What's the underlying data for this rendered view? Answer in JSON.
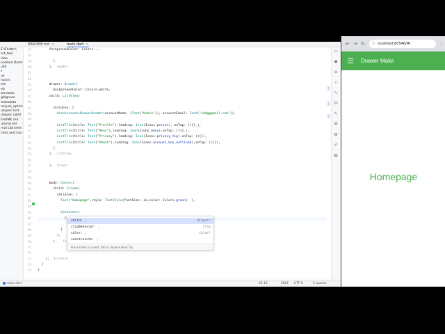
{
  "ide": {
    "tabs": [
      {
        "label": "README.md",
        "active": false
      },
      {
        "label": "main.dart",
        "active": true
      }
    ],
    "project_tree": [
      "E:\\Flutter\\",
      "art_tool",
      "idea",
      "android [tutorial",
      "uild",
      "s",
      "ux",
      "nacos",
      "est",
      "eb",
      "windows",
      "gitignore",
      "metadata",
      "nalysis_options",
      "ubspec.lock",
      "ubspec.yaml",
      "EADME.md",
      "utorial.iml",
      "rnal Libraries",
      "ches and Con"
    ],
    "line_numbers": [
      "37",
      "38",
      "39",
      "40",
      "41",
      "42",
      "43",
      "44",
      "45",
      "46",
      "47",
      "48",
      "49",
      "50",
      "51",
      "52",
      "53",
      "54",
      "55",
      "56",
      "57",
      "58",
      "59",
      "60",
      "61",
      "62",
      "63",
      "64",
      "65",
      "66",
      "67",
      "68",
      "69",
      "70",
      "71",
      "72",
      "73",
      "74",
      "75"
    ],
    "code_lines": [
      {
        "indent": "      ",
        "parts": [
          {
            "t": "foregroundColor: Colors.",
            "c": ""
          },
          {
            "t": "...",
            "c": ""
          }
        ]
      },
      {
        "indent": "",
        "parts": []
      },
      {
        "indent": "        ",
        "parts": [
          {
            "t": "],",
            "c": ""
          }
        ]
      },
      {
        "indent": "      ",
        "parts": [
          {
            "t": "),",
            "c": ""
          }
        ],
        "tag": "AppBar"
      },
      {
        "indent": "",
        "parts": []
      },
      {
        "indent": "",
        "parts": []
      },
      {
        "indent": "      ",
        "parts": [
          {
            "t": "drawer: ",
            "c": ""
          },
          {
            "t": "Drawer",
            "c": "cls"
          },
          {
            "t": "(",
            "c": ""
          }
        ]
      },
      {
        "indent": "        ",
        "parts": [
          {
            "t": "backgroundColor: Colors.white,",
            "c": ""
          }
        ]
      },
      {
        "indent": "      ",
        "parts": [
          {
            "t": "child: ",
            "c": ""
          },
          {
            "t": "ListView",
            "c": "cls"
          },
          {
            "t": "(",
            "c": ""
          }
        ]
      },
      {
        "indent": "",
        "parts": []
      },
      {
        "indent": "        ",
        "parts": [
          {
            "t": "children: [",
            "c": ""
          }
        ]
      },
      {
        "indent": "          ",
        "parts": [
          {
            "t": "UserAccountsDrawerHeader",
            "c": "cls"
          },
          {
            "t": "(accountName: (",
            "c": ""
          },
          {
            "t": "Text",
            "c": "cls"
          },
          {
            "t": "(",
            "c": ""
          },
          {
            "t": "\"Komin\"",
            "c": "str"
          },
          {
            "t": ")), accountEmail: ",
            "c": ""
          },
          {
            "t": "Text",
            "c": "cls"
          },
          {
            "t": "(",
            "c": ""
          },
          {
            "t": "\"sddg@gmail.com\"",
            "c": "str"
          },
          {
            "t": ")),",
            "c": ""
          }
        ]
      },
      {
        "indent": "",
        "parts": []
      },
      {
        "indent": "          ",
        "parts": [
          {
            "t": "ListTile",
            "c": "cls"
          },
          {
            "t": "(title: ",
            "c": ""
          },
          {
            "t": "Text",
            "c": "cls"
          },
          {
            "t": "(",
            "c": ""
          },
          {
            "t": "\"Profile\"",
            "c": "str"
          },
          {
            "t": "),leading: ",
            "c": ""
          },
          {
            "t": "Icon",
            "c": "cls"
          },
          {
            "t": "(Icons.",
            "c": ""
          },
          {
            "t": "person",
            "c": "kw"
          },
          {
            "t": "), onTap: (){}_),",
            "c": ""
          }
        ]
      },
      {
        "indent": "          ",
        "parts": [
          {
            "t": "ListTile",
            "c": "cls"
          },
          {
            "t": "(title: ",
            "c": ""
          },
          {
            "t": "Text",
            "c": "cls"
          },
          {
            "t": "(",
            "c": ""
          },
          {
            "t": "\"Menu\"",
            "c": "str"
          },
          {
            "t": "),leading: ",
            "c": ""
          },
          {
            "t": "Icon",
            "c": "cls"
          },
          {
            "t": "(Icons.",
            "c": ""
          },
          {
            "t": "menu",
            "c": "kw"
          },
          {
            "t": "),onTap: (){}_),",
            "c": ""
          }
        ]
      },
      {
        "indent": "          ",
        "parts": [
          {
            "t": "ListTile",
            "c": "cls"
          },
          {
            "t": "(title: ",
            "c": ""
          },
          {
            "t": "Text",
            "c": "cls"
          },
          {
            "t": "(",
            "c": ""
          },
          {
            "t": "\"Privacy\"",
            "c": "str"
          },
          {
            "t": "),leading: ",
            "c": ""
          },
          {
            "t": "Icon",
            "c": "cls"
          },
          {
            "t": "(Icons.",
            "c": ""
          },
          {
            "t": "privacy_tip",
            "c": "kw"
          },
          {
            "t": "),onTap: (){}),",
            "c": ""
          }
        ]
      },
      {
        "indent": "          ",
        "parts": [
          {
            "t": "ListTile",
            "c": "cls"
          },
          {
            "t": "(title: ",
            "c": ""
          },
          {
            "t": "Text",
            "c": "cls"
          },
          {
            "t": "(",
            "c": ""
          },
          {
            "t": "\"About\"",
            "c": "str"
          },
          {
            "t": "),leading: ",
            "c": ""
          },
          {
            "t": "Icon",
            "c": "cls"
          },
          {
            "t": "(Icons.",
            "c": ""
          },
          {
            "t": "account_box_outlined",
            "c": "kw"
          },
          {
            "t": "),onTap: (){}),",
            "c": ""
          }
        ]
      },
      {
        "indent": "        ",
        "parts": [
          {
            "t": "],",
            "c": ""
          }
        ]
      },
      {
        "indent": "      ",
        "parts": [
          {
            "t": "),",
            "c": ""
          }
        ],
        "tag": "ListView"
      },
      {
        "indent": "",
        "parts": []
      },
      {
        "indent": "      ",
        "parts": [
          {
            "t": "),",
            "c": ""
          }
        ],
        "tag": "Drawer"
      },
      {
        "indent": "",
        "parts": []
      },
      {
        "indent": "",
        "parts": []
      },
      {
        "indent": "      ",
        "parts": [
          {
            "t": "body: ",
            "c": ""
          },
          {
            "t": "Center",
            "c": "cls"
          },
          {
            "t": "(",
            "c": ""
          }
        ]
      },
      {
        "indent": "        ",
        "parts": [
          {
            "t": "child: ",
            "c": ""
          },
          {
            "t": "Column",
            "c": "cls"
          },
          {
            "t": "(",
            "c": ""
          }
        ]
      },
      {
        "indent": "          ",
        "parts": [
          {
            "t": "children: [",
            "c": ""
          }
        ]
      },
      {
        "indent": "            ",
        "parts": [
          {
            "t": "Text",
            "c": "cls"
          },
          {
            "t": "(",
            "c": ""
          },
          {
            "t": "\"Homepage\"",
            "c": "str"
          },
          {
            "t": ",style: ",
            "c": ""
          },
          {
            "t": "TextStyle",
            "c": "cls"
          },
          {
            "t": "(fontSize: 3a,color: Colors.",
            "c": ""
          },
          {
            "t": "green",
            "c": "kw"
          },
          {
            "t": ")  ),",
            "c": ""
          }
        ]
      },
      {
        "indent": "",
        "parts": []
      },
      {
        "indent": "            ",
        "parts": [
          {
            "t": "Container",
            "c": "cls"
          },
          {
            "t": "(",
            "c": ""
          }
        ]
      },
      {
        "indent": "              ",
        "parts": [
          {
            "t": "c",
            "c": ""
          }
        ]
      },
      {
        "indent": "",
        "parts": []
      },
      {
        "indent": "            ",
        "parts": [
          {
            "t": "]",
            "c": ""
          }
        ]
      },
      {
        "indent": "          ",
        "parts": [
          {
            "t": "),",
            "c": ""
          }
        ]
      },
      {
        "indent": "        ",
        "parts": [
          {
            "t": "), ",
            "c": ""
          }
        ],
        "tag": "Cen"
      },
      {
        "indent": "",
        "parts": []
      },
      {
        "indent": "",
        "parts": []
      },
      {
        "indent": "    ",
        "parts": [
          {
            "t": ");",
            "c": ""
          }
        ],
        "tag": "Scaffold"
      },
      {
        "indent": "  ",
        "parts": [
          {
            "t": "}",
            "c": ""
          }
        ]
      },
      {
        "indent": "}",
        "parts": []
      }
    ],
    "completion": {
      "items": [
        {
          "label": "child: ,",
          "type": "Widget?"
        },
        {
          "label": "clipBehavior: ,",
          "type": "Clip"
        },
        {
          "label": "color: ,",
          "type": "Color?"
        },
        {
          "label": "constraints: ,",
          "type": ""
        }
      ],
      "footer": "Press Enter to insert, Tab to replace  Next Tip",
      "more": "⋮"
    },
    "status": {
      "file": "main.dart",
      "position": "65:16",
      "line_sep": "CRLF",
      "encoding": "UTF-8",
      "indent": "2 spaces"
    },
    "side_icons": [
      "device-icon",
      "flutter-icon",
      "outline-icon",
      "inspector-icon",
      "performance-icon",
      "database-icon",
      "tool-icon",
      "hammer-icon",
      "plugin-icon",
      "pen-icon",
      "doc-icon"
    ]
  },
  "browser": {
    "url": "localhost:60546/#/",
    "app": {
      "title": "Drawer Make",
      "body_text": "Homepage",
      "accent_color": "#4caf50"
    }
  }
}
